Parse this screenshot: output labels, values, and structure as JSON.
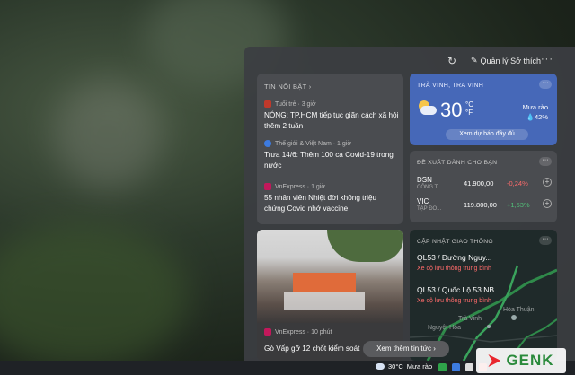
{
  "header": {
    "prefs_label": "Quản lý Sở thích",
    "more": "···",
    "refresh": "↻"
  },
  "news": {
    "section_label": "TIN NỔI BẬT",
    "items": [
      {
        "source": "Tuổi trẻ · 3 giờ",
        "title": "NÓNG: TP.HCM tiếp tục giãn cách xã hội thêm 2 tuần",
        "color": "#c0392b"
      },
      {
        "source": "Thế giới & Việt Nam · 1 giờ",
        "title": "Trưa 14/6: Thêm 100 ca Covid-19 trong nước",
        "color": "#3d7be0"
      },
      {
        "source": "VnExpress · 1 giờ",
        "title": "55 nhân viên Nhiệt đời không triệu chứng Covid nhớ vaccine",
        "color": "#c2185b"
      }
    ]
  },
  "weather": {
    "location": "TRÀ VINH, TRA VINH",
    "temp": "30",
    "unit_c": "°C",
    "unit_f": "°F",
    "rain_label": "Mưa rào",
    "humidity": "42%",
    "forecast_btn": "Xem dự báo đầy đủ"
  },
  "stocks": {
    "section_label": "ĐỀ XUẤT DÀNH CHO BẠN",
    "rows": [
      {
        "symbol": "DSN",
        "company": "CÔNG T...",
        "price": "41.900,00",
        "change": "-0,24%",
        "change_color": "#ff6b6b"
      },
      {
        "symbol": "VIC",
        "company": "TẬP ĐO...",
        "price": "119.800,00",
        "change": "+1,53%",
        "change_color": "#52c27a"
      }
    ]
  },
  "photo_news": {
    "source": "VnExpress · 10 phút",
    "title": "Gò Vấp gỡ 12 chốt kiểm soát"
  },
  "traffic": {
    "section_label": "CẬP NHẬT GIAO THÔNG",
    "routes": [
      {
        "name": "QL53 / Đường Nguy...",
        "status": "Xe cộ lưu thông trung bình"
      },
      {
        "name": "QL53 / Quốc Lộ 53 NB",
        "status": "Xe cộ lưu thông trung bình"
      }
    ],
    "map_labels": [
      "Hòa Thuận",
      "Trà Vinh",
      "Nguyệt Hóa"
    ]
  },
  "more_news_btn": "Xem thêm tin tức ›",
  "taskbar": {
    "temp": "30°C",
    "condition": "Mưa rào"
  },
  "logo_text": "GENK"
}
